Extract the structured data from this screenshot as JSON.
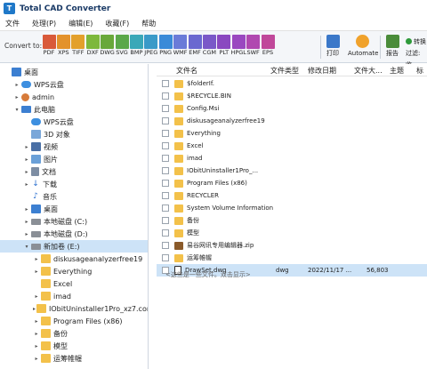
{
  "window": {
    "title": "Total CAD Converter"
  },
  "menu": [
    "文件",
    "处理(P)",
    "编辑(E)",
    "收藏(F)",
    "帮助"
  ],
  "toolbar": {
    "convert_label": "Convert to:",
    "formats": [
      {
        "label": "PDF",
        "color": "#d95a3a"
      },
      {
        "label": "XPS",
        "color": "#e3922c"
      },
      {
        "label": "TIFF",
        "color": "#e3a02c"
      },
      {
        "label": "DXF",
        "color": "#7db83c"
      },
      {
        "label": "DWG",
        "color": "#68a83a"
      },
      {
        "label": "SVG",
        "color": "#5aa84a"
      },
      {
        "label": "BMP",
        "color": "#3aa8b8"
      },
      {
        "label": "JPEG",
        "color": "#3a9ac8"
      },
      {
        "label": "PNG",
        "color": "#3a8ad8"
      },
      {
        "label": "WMF",
        "color": "#6a7bd8"
      },
      {
        "label": "EMF",
        "color": "#6a68d0"
      },
      {
        "label": "CGM",
        "color": "#7a58c8"
      },
      {
        "label": "PLT",
        "color": "#8a48c0"
      },
      {
        "label": "HPGL",
        "color": "#9a48c0"
      },
      {
        "label": "SWF",
        "color": "#b048b0"
      },
      {
        "label": "EPS",
        "color": "#c0489a"
      }
    ],
    "print_label": "打印",
    "automate_label": "Automate",
    "report_label": "报告",
    "side_items": [
      "转换",
      "过滤:",
      "收"
    ]
  },
  "tree": [
    {
      "label": "桌面",
      "icon": "desktop-icon",
      "indent": 0,
      "expander": ""
    },
    {
      "label": "WPS云盘",
      "icon": "cloud-icon",
      "indent": 1,
      "expander": "▸"
    },
    {
      "label": "admin",
      "icon": "user-icon",
      "indent": 1,
      "expander": "▸"
    },
    {
      "label": "此电脑",
      "icon": "computer-icon",
      "indent": 1,
      "expander": "▾"
    },
    {
      "label": "WPS云盘",
      "icon": "cloud-icon",
      "indent": 2,
      "expander": ""
    },
    {
      "label": "3D 对象",
      "icon": "3d-objects-icon",
      "indent": 2,
      "expander": ""
    },
    {
      "label": "视频",
      "icon": "video-icon",
      "indent": 2,
      "expander": "▸"
    },
    {
      "label": "图片",
      "icon": "pictures-icon",
      "indent": 2,
      "expander": "▸"
    },
    {
      "label": "文档",
      "icon": "documents-icon",
      "indent": 2,
      "expander": "▸"
    },
    {
      "label": "下载",
      "icon": "download-icon",
      "indent": 2,
      "expander": "▸"
    },
    {
      "label": "音乐",
      "icon": "music-icon",
      "indent": 2,
      "expander": ""
    },
    {
      "label": "桌面",
      "icon": "desktop-icon",
      "indent": 2,
      "expander": "▸"
    },
    {
      "label": "本地磁盘 (C:)",
      "icon": "drive-icon",
      "indent": 2,
      "expander": "▸"
    },
    {
      "label": "本地磁盘 (D:)",
      "icon": "drive-icon",
      "indent": 2,
      "expander": "▸"
    },
    {
      "label": "新加卷 (E:)",
      "icon": "drive-icon",
      "indent": 2,
      "expander": "▾",
      "selected": true
    },
    {
      "label": "diskusageanalyzerfree19",
      "icon": "folder-icon",
      "indent": 3,
      "expander": "▸"
    },
    {
      "label": "Everything",
      "icon": "folder-icon",
      "indent": 3,
      "expander": "▸"
    },
    {
      "label": "Excel",
      "icon": "folder-icon",
      "indent": 3,
      "expander": ""
    },
    {
      "label": "imad",
      "icon": "folder-icon",
      "indent": 3,
      "expander": "▸"
    },
    {
      "label": "IObitUninstaller1Pro_xz7.com",
      "icon": "folder-icon",
      "indent": 3,
      "expander": "▸"
    },
    {
      "label": "Program Files (x86)",
      "icon": "folder-icon",
      "indent": 3,
      "expander": "▸"
    },
    {
      "label": "备份",
      "icon": "folder-icon",
      "indent": 3,
      "expander": "▸"
    },
    {
      "label": "模型",
      "icon": "folder-icon",
      "indent": 3,
      "expander": "▸"
    },
    {
      "label": "运筹帷幄",
      "icon": "folder-icon",
      "indent": 3,
      "expander": "▸"
    }
  ],
  "list": {
    "headers": [
      "文件名",
      "文件类型",
      "修改日期",
      "文件大...",
      "主题",
      "标"
    ],
    "rows": [
      {
        "name": "$folderIf.",
        "kind": "folder"
      },
      {
        "name": "$RECYCLE.BIN",
        "kind": "folder"
      },
      {
        "name": "Config.Msi",
        "kind": "folder"
      },
      {
        "name": "diskusageanalyzerfree19",
        "kind": "folder"
      },
      {
        "name": "Everything",
        "kind": "folder"
      },
      {
        "name": "Excel",
        "kind": "folder"
      },
      {
        "name": "imad",
        "kind": "folder"
      },
      {
        "name": "IObitUninstaller1Pro_...",
        "kind": "folder"
      },
      {
        "name": "Program Files (x86)",
        "kind": "folder"
      },
      {
        "name": "RECYCLER",
        "kind": "folder"
      },
      {
        "name": "System Volume Information",
        "kind": "folder"
      },
      {
        "name": "备份",
        "kind": "folder"
      },
      {
        "name": "模型",
        "kind": "folder"
      },
      {
        "name": "易谷网讯专用编辑器.zip",
        "kind": "zip"
      },
      {
        "name": "运筹帷幄",
        "kind": "folder"
      },
      {
        "name": "DrawSet.dwg",
        "kind": "dwg",
        "type": "dwg",
        "date": "2022/11/17 ...",
        "size": "56,803",
        "selected": true
      }
    ],
    "status": "<这些是一些文件。双击显示>"
  }
}
